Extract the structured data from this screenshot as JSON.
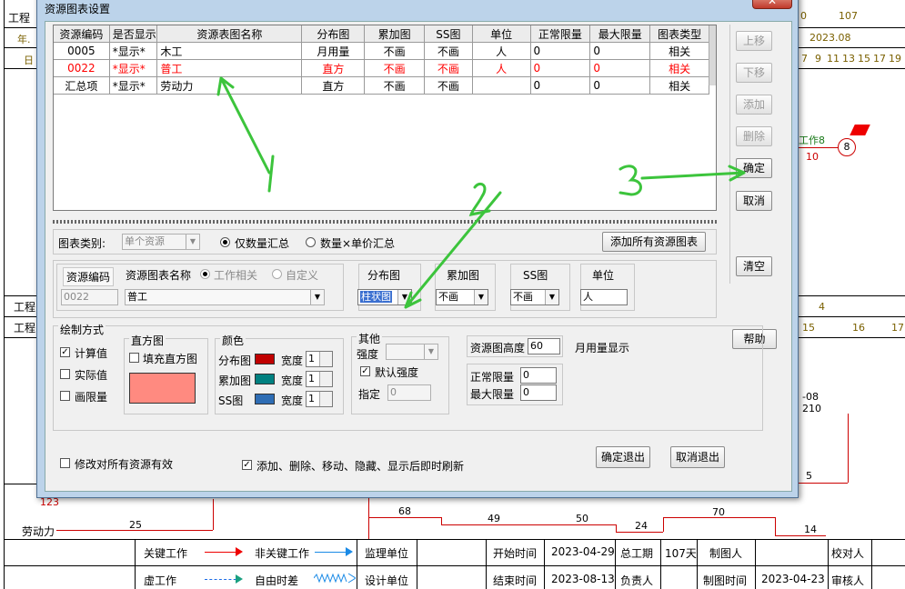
{
  "background": {
    "top_left_labels": [
      "工程",
      "年.",
      "日"
    ],
    "top_right_numbers": [
      "0",
      "107"
    ],
    "date_label": "2023.08",
    "day_numbers": [
      "7",
      "9",
      "11",
      "13",
      "15",
      "17",
      "19"
    ],
    "left_labels": [
      "工程",
      "工程"
    ],
    "mid_numbers": [
      "4",
      "15",
      "16",
      "17"
    ],
    "work_label": "工作8",
    "node_number": "8",
    "work_value": "10",
    "right_vals": [
      "-08",
      "210",
      "5"
    ],
    "left_side_123": "123",
    "labor_label": "劳动力",
    "labor_values": [
      "25",
      "68",
      "49",
      "50",
      "24",
      "70",
      "14"
    ]
  },
  "legend": {
    "critical_work": "关键工作",
    "noncritical_work": "非关键工作",
    "virtual_work": "虚工作",
    "free_float": "自由时差",
    "supervisor": "监理单位",
    "designer": "设计单位",
    "start_time_label": "开始时间",
    "start_time": "2023-04-29",
    "end_time_label": "结束时间",
    "end_time": "2023-08-13",
    "total_duration_label": "总工期",
    "total_duration": "107天",
    "responsible_label": "负责人",
    "drawer_label": "制图人",
    "draw_time_label": "制图时间",
    "draw_time": "2023-04-23",
    "checker_label": "校对人",
    "reviewer_label": "审核人"
  },
  "dialog": {
    "title": "资源图表设置",
    "close": "✕",
    "table": {
      "headers": [
        "资源编码",
        "是否显示",
        "资源表图名称",
        "分布图",
        "累加图",
        "SS图",
        "单位",
        "正常限量",
        "最大限量",
        "图表类型"
      ],
      "rows": [
        [
          "0005",
          "*显示*",
          "木工",
          "月用量",
          "不画",
          "不画",
          "人",
          "0",
          "0",
          "相关"
        ],
        [
          "0022",
          "*显示*",
          "普工",
          "直方",
          "不画",
          "不画",
          "人",
          "0",
          "0",
          "相关"
        ],
        [
          "汇总项",
          "*显示*",
          "劳动力",
          "直方",
          "不画",
          "不画",
          "",
          "0",
          "0",
          "相关"
        ]
      ],
      "highlight_color": "#ff0000"
    },
    "side_buttons": {
      "up": "上移",
      "down": "下移",
      "add": "添加",
      "delete": "删除",
      "ok": "确定",
      "cancel": "取消",
      "clear": "清空",
      "help": "帮助"
    },
    "chart_category_label": "图表类别:",
    "chart_category_value": "单个资源",
    "radio_qty": "仅数量汇总",
    "radio_qty_price": "数量×单价汇总",
    "add_all_button": "添加所有资源图表",
    "fields": {
      "code_label": "资源编码",
      "code_value": "0022",
      "name_label": "资源图表名称",
      "radio_related": "工作相关",
      "radio_custom": "自定义",
      "name_value": "普工",
      "dist_label": "分布图",
      "dist_value": "柱状图",
      "accum_label": "累加图",
      "accum_value": "不画",
      "ss_label": "SS图",
      "ss_value": "不画",
      "unit_label": "单位",
      "unit_value": "人"
    },
    "draw_mode": {
      "title": "绘制方式",
      "calc_value": "计算值",
      "actual_value": "实际值",
      "draw_limit": "画限量",
      "histogram_title": "直方图",
      "fill_histogram": "填充直方图",
      "histogram_color": "#ff8a80",
      "color_title": "颜色",
      "dist_color_label": "分布图",
      "accum_color_label": "累加图",
      "ss_color_label": "SS图",
      "width_label": "宽度",
      "dist_color": "#c00000",
      "accum_color": "#008080",
      "ss_color": "#2e6db4",
      "width_values": [
        "1",
        "1",
        "1"
      ],
      "other_title": "其他",
      "intensity_label": "强度",
      "default_intensity": "默认强度",
      "specify_label": "指定",
      "specify_value": "0",
      "height_label": "资源图高度",
      "height_value": "60",
      "monthly_display": "月用量显示",
      "normal_limit_label": "正常限量",
      "normal_limit_value": "0",
      "max_limit_label": "最大限量",
      "max_limit_value": "0"
    },
    "bottom": {
      "apply_all": "修改对所有资源有效",
      "refresh": "添加、删除、移动、隐藏、显示后即时刷新",
      "ok_exit": "确定退出",
      "cancel_exit": "取消退出"
    },
    "annotations": {
      "mark1": "1",
      "mark2": "2",
      "mark3": "3",
      "arrow_color": "#3cc43c"
    }
  }
}
